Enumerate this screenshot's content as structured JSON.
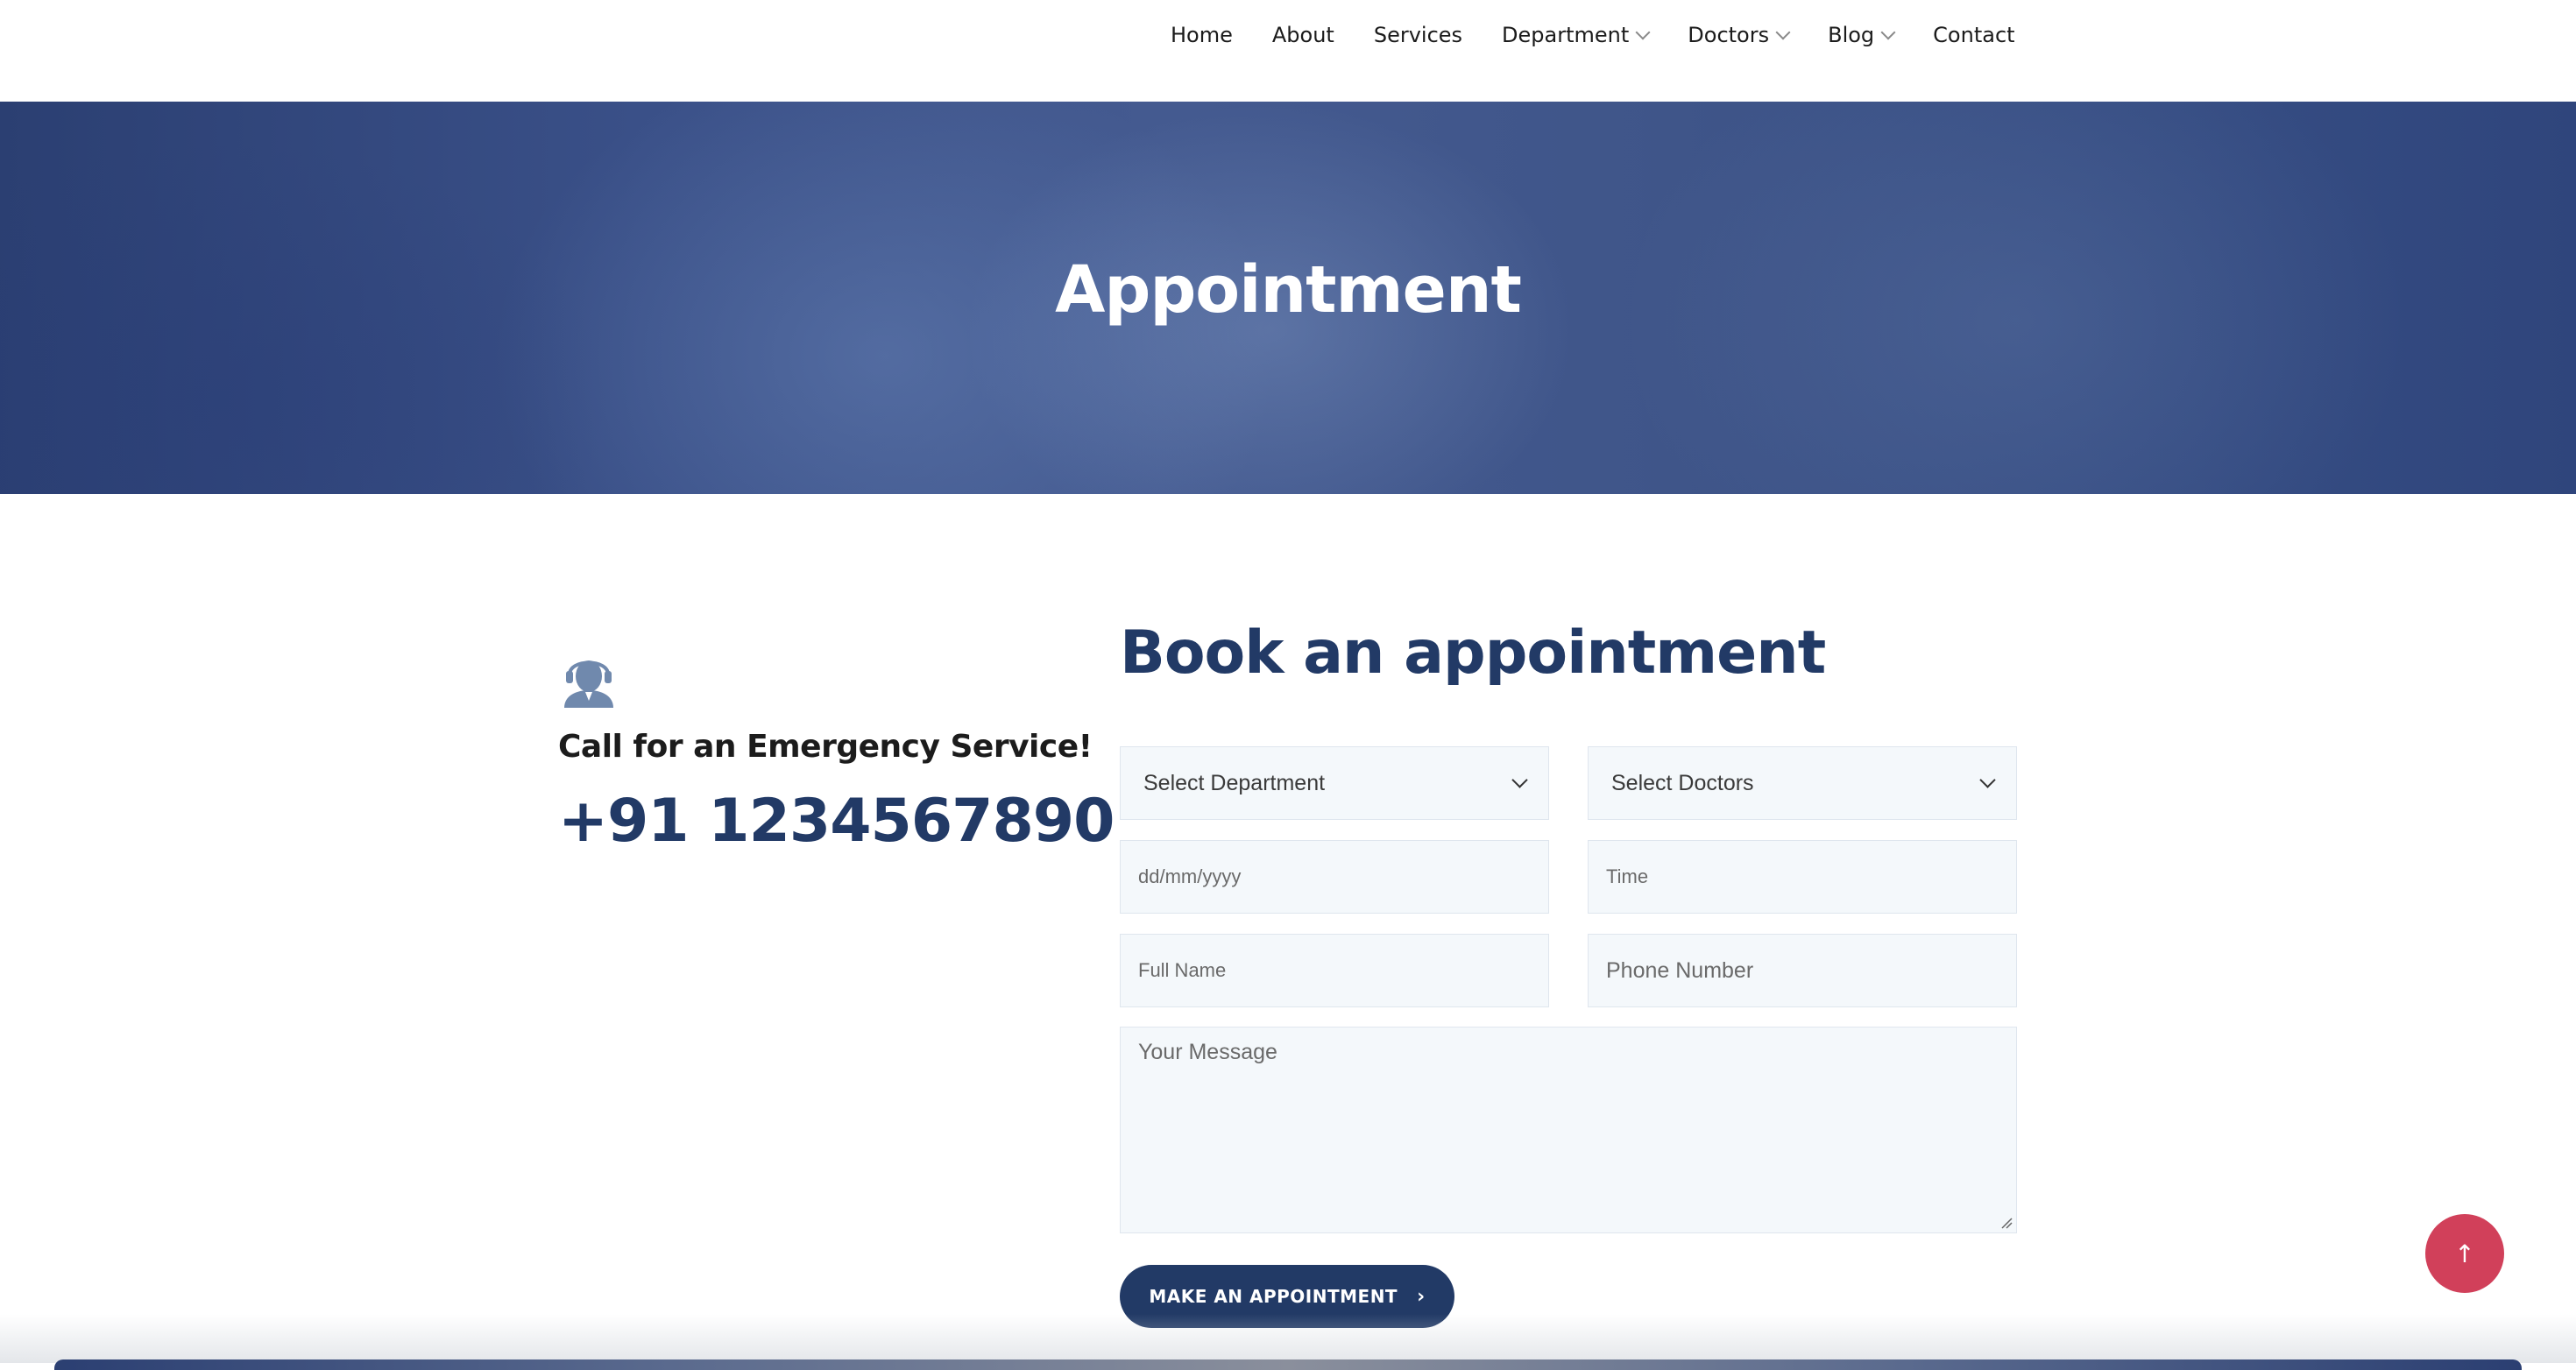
{
  "nav": {
    "items": [
      {
        "label": "Home",
        "has_dropdown": false
      },
      {
        "label": "About",
        "has_dropdown": false
      },
      {
        "label": "Services",
        "has_dropdown": false
      },
      {
        "label": "Department",
        "has_dropdown": true
      },
      {
        "label": "Doctors",
        "has_dropdown": true
      },
      {
        "label": "Blog",
        "has_dropdown": true
      },
      {
        "label": "Contact",
        "has_dropdown": false
      }
    ]
  },
  "hero": {
    "title": "Appointment"
  },
  "emergency": {
    "icon": "support-agent-icon",
    "title": "Call for an Emergency Service!",
    "phone": "+91 1234567890"
  },
  "form": {
    "title": "Book an appointment",
    "department": {
      "selected": "Select Department"
    },
    "doctor": {
      "selected": "Select Doctors"
    },
    "date": {
      "placeholder": "dd/mm/yyyy"
    },
    "time": {
      "placeholder": "Time"
    },
    "full_name": {
      "placeholder": "Full Name"
    },
    "phone": {
      "placeholder": "Phone Number"
    },
    "message": {
      "placeholder": "Your Message"
    },
    "submit_label": "MAKE AN APPOINTMENT",
    "submit_arrow": "›"
  },
  "scroll_top": {
    "icon": "arrow-up-icon",
    "glyph": "↑"
  },
  "colors": {
    "primary": "#223a66",
    "accent": "#d1405a",
    "field_bg": "#f4f8fb"
  }
}
